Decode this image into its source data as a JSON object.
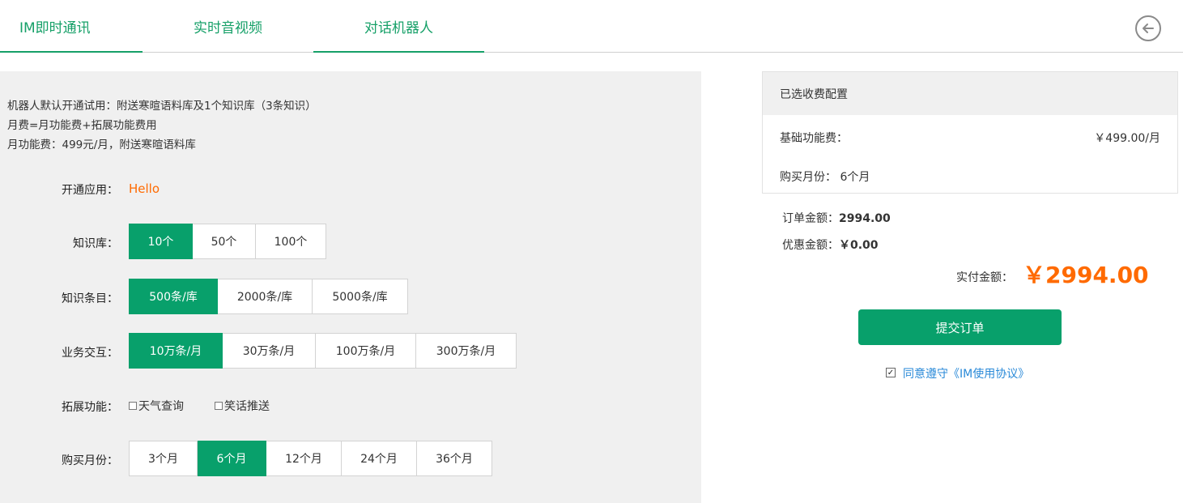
{
  "tabs": [
    {
      "label": "IM即时通讯",
      "active": true
    },
    {
      "label": "实时音视频",
      "active": false
    },
    {
      "label": "对话机器人",
      "active": true
    }
  ],
  "back_icon": "arrow-left-circle-icon",
  "intro": {
    "line1": "机器人默认开通试用：附送寒暄语料库及1个知识库（3条知识）",
    "line2": "月费=月功能费+拓展功能费用",
    "line3": "月功能费：499元/月，附送寒暄语料库"
  },
  "app": {
    "label": "开通应用：",
    "value": "Hello"
  },
  "knowledge_base": {
    "label": "知识库：",
    "options": [
      "10个",
      "50个",
      "100个"
    ],
    "selected": "10个"
  },
  "knowledge_items": {
    "label": "知识条目：",
    "options": [
      "500条/库",
      "2000条/库",
      "5000条/库"
    ],
    "selected": "500条/库"
  },
  "interaction": {
    "label": "业务交互：",
    "options": [
      "10万条/月",
      "30万条/月",
      "100万条/月",
      "300万条/月"
    ],
    "selected": "10万条/月"
  },
  "extensions": {
    "label": "拓展功能：",
    "items": [
      {
        "label": "天气查询",
        "checked": false
      },
      {
        "label": "笑话推送",
        "checked": false
      }
    ]
  },
  "months": {
    "label": "购买月份：",
    "options": [
      "3个月",
      "6个月",
      "12个月",
      "24个月",
      "36个月"
    ],
    "selected": "6个月"
  },
  "summary": {
    "title": "已选收费配置",
    "base_fee_label": "基础功能费：",
    "base_fee_value": "￥499.00/月",
    "months_label": "购买月份：",
    "months_value": "6个月"
  },
  "order": {
    "amount_label": "订单金额：",
    "amount_value": "2994.00",
    "discount_label": "优惠金额：",
    "discount_value": "￥0.00",
    "pay_label": "实付金额：",
    "pay_value": "￥2994.00"
  },
  "submit_label": "提交订单",
  "agreement": {
    "checked": true,
    "label": "同意遵守《IM使用协议》"
  },
  "colors": {
    "accent": "#08a06b",
    "highlight": "#ff6a00",
    "link": "#2a8ad8"
  }
}
